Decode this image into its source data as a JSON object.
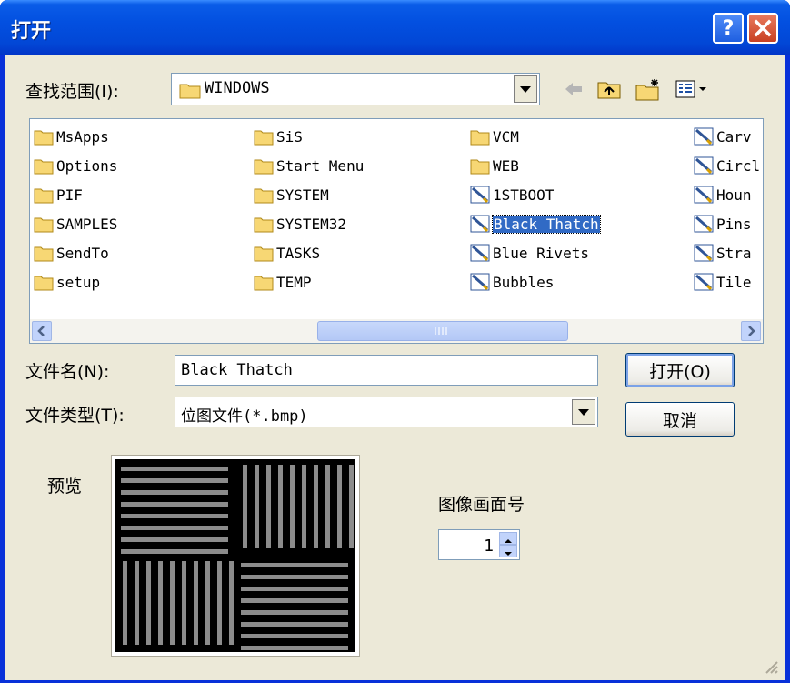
{
  "window": {
    "title": "打开"
  },
  "lookin": {
    "label": "查找范围(I):",
    "value": "WINDOWS"
  },
  "files": [
    {
      "name": "MsApps",
      "type": "folder"
    },
    {
      "name": "Options",
      "type": "folder"
    },
    {
      "name": "PIF",
      "type": "folder"
    },
    {
      "name": "SAMPLES",
      "type": "folder"
    },
    {
      "name": "SendTo",
      "type": "folder"
    },
    {
      "name": "setup",
      "type": "folder"
    },
    {
      "name": "SiS",
      "type": "folder"
    },
    {
      "name": "Start Menu",
      "type": "folder"
    },
    {
      "name": "SYSTEM",
      "type": "folder"
    },
    {
      "name": "SYSTEM32",
      "type": "folder"
    },
    {
      "name": "TASKS",
      "type": "folder"
    },
    {
      "name": "TEMP",
      "type": "folder"
    },
    {
      "name": "VCM",
      "type": "folder"
    },
    {
      "name": "WEB",
      "type": "folder"
    },
    {
      "name": "1STBOOT",
      "type": "bitmap"
    },
    {
      "name": "Black Thatch",
      "type": "bitmap",
      "selected": true
    },
    {
      "name": "Blue Rivets",
      "type": "bitmap"
    },
    {
      "name": "Bubbles",
      "type": "bitmap"
    },
    {
      "name": "Carv",
      "type": "bitmap"
    },
    {
      "name": "Circl",
      "type": "bitmap"
    },
    {
      "name": "Houn",
      "type": "bitmap"
    },
    {
      "name": "Pins",
      "type": "bitmap"
    },
    {
      "name": "Stra",
      "type": "bitmap"
    },
    {
      "name": "Tile",
      "type": "bitmap"
    }
  ],
  "filename": {
    "label": "文件名(N):",
    "value": "Black Thatch"
  },
  "filetype": {
    "label": "文件类型(T):",
    "value": "位图文件(*.bmp)"
  },
  "buttons": {
    "open": "打开(O)",
    "cancel": "取消"
  },
  "preview": {
    "label": "预览"
  },
  "frame": {
    "label": "图像画面号",
    "value": "1"
  },
  "colors": {
    "titlebar": "#0a5ce8",
    "client": "#ece9d8",
    "selection": "#316ac5",
    "close": "#c84022"
  }
}
